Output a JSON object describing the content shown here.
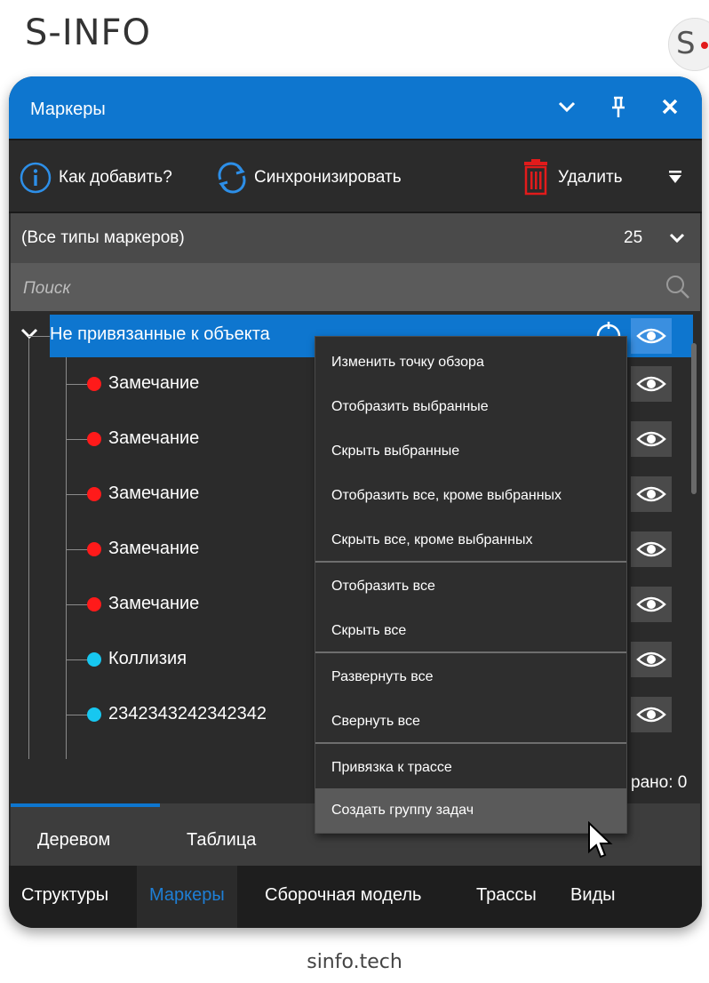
{
  "brand": {
    "name": "S-INFO",
    "logo_letter": "S",
    "footer": "sinfo.tech"
  },
  "window": {
    "title": "Маркеры",
    "toolbar": {
      "help_label": "Как добавить?",
      "sync_label": "Синхронизировать",
      "delete_label": "Удалить"
    },
    "filter": {
      "selected": "(Все типы маркеров)",
      "count": "25"
    },
    "search": {
      "placeholder": "Поиск"
    },
    "tree": {
      "root": {
        "label": "Не привязанные к объекта",
        "expanded": true
      },
      "items": [
        {
          "label": "Замечание",
          "color": "#ff1a1a"
        },
        {
          "label": "Замечание",
          "color": "#ff1a1a"
        },
        {
          "label": "Замечание",
          "color": "#ff1a1a"
        },
        {
          "label": "Замечание",
          "color": "#ff1a1a"
        },
        {
          "label": "Замечание",
          "color": "#ff1a1a"
        },
        {
          "label": "Коллизия",
          "color": "#17c7f0"
        },
        {
          "label": "2342343242342342",
          "color": "#17c7f0"
        }
      ]
    },
    "status": {
      "selected_label": "рано: 0"
    },
    "view_tabs": [
      "Деревом",
      "Таблица"
    ],
    "bottom_tabs": [
      {
        "label": "Структуры",
        "active": false
      },
      {
        "label": "Маркеры",
        "active": true
      },
      {
        "label": "Сборочная модель",
        "active": false
      },
      {
        "label": "Трассы",
        "active": false
      },
      {
        "label": "Виды",
        "active": false
      }
    ]
  },
  "context_menu": {
    "items": [
      "Изменить точку обзора",
      "Отобразить выбранные",
      "Скрыть выбранные",
      "Отобразить все, кроме выбранных",
      "Скрыть все, кроме выбранных",
      "Отобразить все",
      "Скрыть все",
      "Развернуть все",
      "Свернуть все",
      "Привязка к трассе",
      "Создать группу задач"
    ],
    "hovered": "Создать группу задач"
  },
  "colors": {
    "accent": "#0e76cf",
    "marker_remark": "#ff1a1a",
    "marker_collision": "#17c7f0",
    "delete_icon": "#e21b1b"
  }
}
